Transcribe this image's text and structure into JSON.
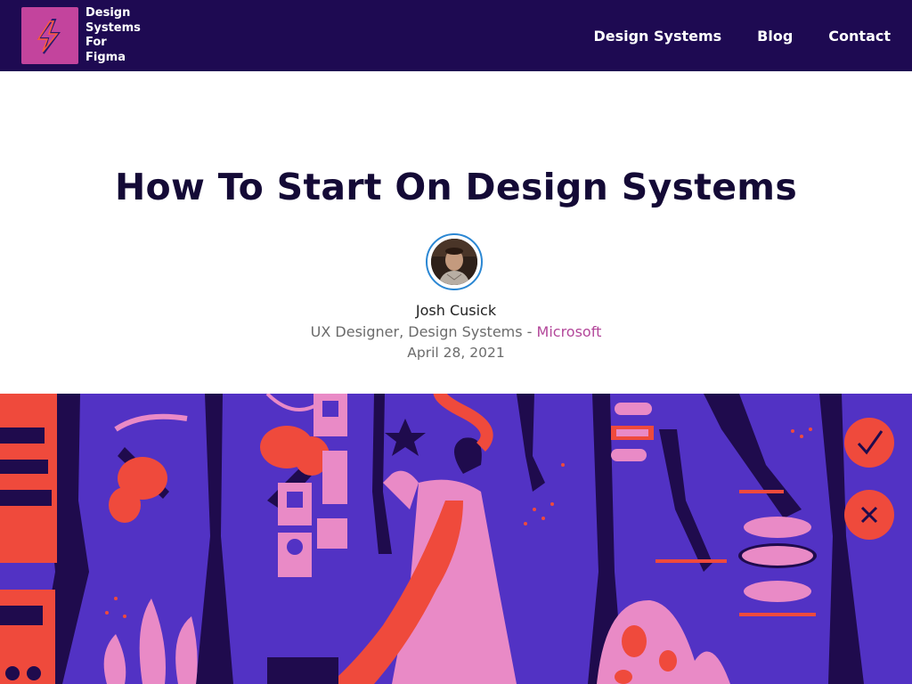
{
  "header": {
    "logo_lines": [
      "Design",
      "Systems",
      "For",
      "Figma"
    ],
    "nav": [
      {
        "label": "Design Systems"
      },
      {
        "label": "Blog"
      },
      {
        "label": "Contact"
      }
    ]
  },
  "article": {
    "title": "How To Start On Design Systems",
    "author": {
      "name": "Josh Cusick",
      "role": "UX Designer, Design Systems - ",
      "company": "Microsoft"
    },
    "date": "April 28, 2021"
  },
  "colors": {
    "header_bg": "#1e0a52",
    "logo_bg": "#c3449d",
    "accent": "#b3479a",
    "hero_bg": "#5030c0"
  },
  "icons": {
    "logo": "lightning-bolt-icon",
    "check": "check-icon",
    "cross": "x-icon"
  }
}
